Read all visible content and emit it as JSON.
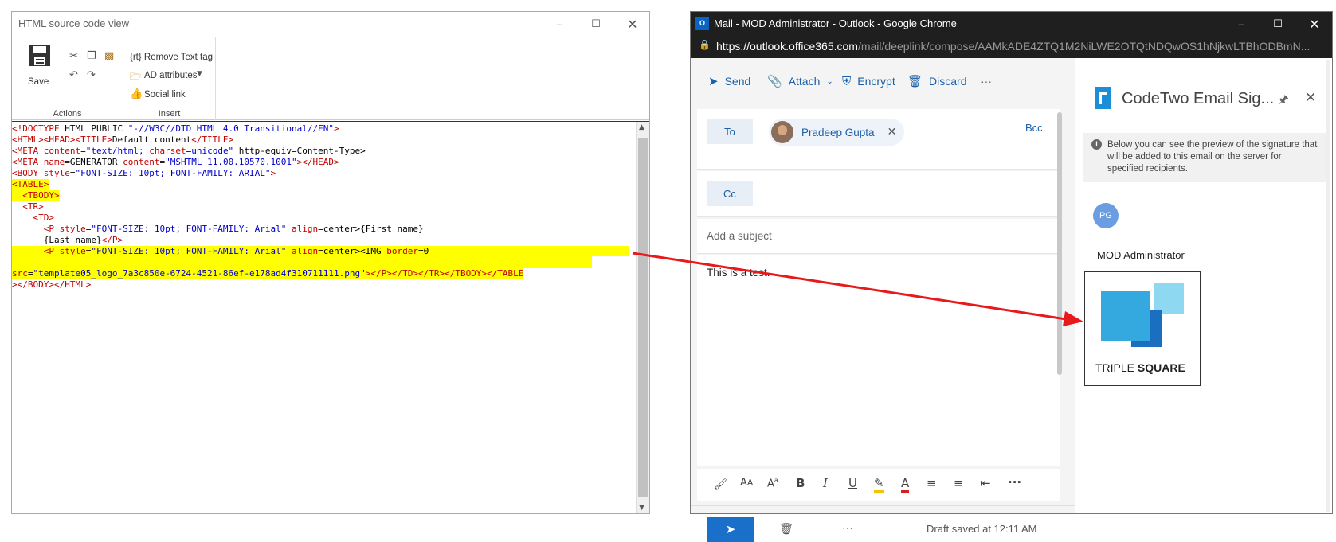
{
  "left_window": {
    "title": "HTML source code view",
    "ribbon": {
      "save_label": "Save",
      "actions_label": "Actions",
      "insert_label": "Insert",
      "remove_text_tag": "{rt} Remove Text tag",
      "ad_attributes": "AD attributes",
      "social_link": "Social link"
    },
    "code_lines": [
      [
        {
          "t": "<!DOCTYPE ",
          "c": "r"
        },
        {
          "t": "HTML PUBLIC ",
          "c": "k"
        },
        {
          "t": "\"-//W3C//DTD HTML 4.0 Transitional//EN\"",
          "c": "b"
        },
        {
          "t": ">",
          "c": "r"
        }
      ],
      [
        {
          "t": "<HTML><HEAD><TITLE>",
          "c": "r"
        },
        {
          "t": "Default content",
          "c": "k"
        },
        {
          "t": "</TITLE>",
          "c": "r"
        }
      ],
      [
        {
          "t": "<META ",
          "c": "r"
        },
        {
          "t": "content",
          "c": "r"
        },
        {
          "t": "=",
          "c": "k"
        },
        {
          "t": "\"text/html; ",
          "c": "b"
        },
        {
          "t": "charset",
          "c": "r"
        },
        {
          "t": "=",
          "c": "k"
        },
        {
          "t": "unicode\"",
          "c": "b"
        },
        {
          "t": " http-equiv=Content-Type>",
          "c": "k"
        }
      ],
      [
        {
          "t": "<META ",
          "c": "r"
        },
        {
          "t": "name",
          "c": "r"
        },
        {
          "t": "=GENERATOR ",
          "c": "k"
        },
        {
          "t": "content",
          "c": "r"
        },
        {
          "t": "=",
          "c": "k"
        },
        {
          "t": "\"MSHTML 11.00.10570.1001\"",
          "c": "b"
        },
        {
          "t": "></HEAD>",
          "c": "r"
        }
      ],
      [
        {
          "t": "<BODY ",
          "c": "r"
        },
        {
          "t": "style",
          "c": "r"
        },
        {
          "t": "=",
          "c": "k"
        },
        {
          "t": "\"FONT-SIZE: 10pt; FONT-FAMILY: ARIAL\"",
          "c": "b"
        },
        {
          "t": ">",
          "c": "r"
        }
      ],
      [
        {
          "t": "<TABLE>",
          "c": "r",
          "hl": true
        }
      ],
      [
        {
          "t": "  <TBODY>",
          "c": "r",
          "hl": true
        }
      ],
      [
        {
          "t": "  <TR>",
          "c": "r"
        }
      ],
      [
        {
          "t": "    <TD>",
          "c": "r"
        }
      ],
      [
        {
          "t": "      <P ",
          "c": "r"
        },
        {
          "t": "style",
          "c": "r"
        },
        {
          "t": "=",
          "c": "k"
        },
        {
          "t": "\"FONT-SIZE: 10pt; FONT-FAMILY: Arial\"",
          "c": "b"
        },
        {
          "t": " ",
          "c": "k"
        },
        {
          "t": "align",
          "c": "r"
        },
        {
          "t": "=center>{First name}",
          "c": "k"
        }
      ],
      [
        {
          "t": "      {Last name}",
          "c": "k"
        },
        {
          "t": "</P>",
          "c": "r"
        }
      ],
      [
        {
          "t": "      <P ",
          "c": "r",
          "hl": true
        },
        {
          "t": "style",
          "c": "r",
          "hl": true
        },
        {
          "t": "=",
          "c": "k",
          "hl": true
        },
        {
          "t": "\"FONT-SIZE: 10pt; FONT-FAMILY: Arial\"",
          "c": "b",
          "hl": true
        },
        {
          "t": " ",
          "c": "k",
          "hl": true
        },
        {
          "t": "align",
          "c": "r",
          "hl": true
        },
        {
          "t": "=center><IMG ",
          "c": "k",
          "hl": true
        },
        {
          "t": "border",
          "c": "r",
          "hl": true
        },
        {
          "t": "=0                                      ",
          "c": "k",
          "hl": true
        }
      ],
      [
        {
          "t": "                                                                                                              ",
          "c": "k",
          "hl": true
        }
      ],
      [
        {
          "t": "src",
          "c": "r",
          "hl": true
        },
        {
          "t": "=",
          "c": "k",
          "hl": true
        },
        {
          "t": "\"template05_logo_7a3c850e-6724-4521-86ef-e178ad4f310711111.png\"",
          "c": "b",
          "hl": true
        },
        {
          "t": "></P></TD></TR></TBODY></TABLE",
          "c": "r",
          "hl": true
        }
      ],
      [
        {
          "t": "></BODY></HTML>",
          "c": "r"
        }
      ]
    ]
  },
  "right_window": {
    "title": "Mail - MOD Administrator - Outlook - Google Chrome",
    "url_host": "https://outlook.office365.com",
    "url_path": "/mail/deeplink/compose/AAMkADE4ZTQ1M2NiLWE2OTQtNDQwOS1hNjkwLTBhODBmN...",
    "toolbar": {
      "send": "Send",
      "attach": "Attach",
      "encrypt": "Encrypt",
      "discard": "Discard",
      "more": "···"
    },
    "to_label": "To",
    "recipient": "Pradeep Gupta",
    "bcc_label": "Bcc",
    "cc_label": "Cc",
    "subject_placeholder": "Add a subject",
    "body_text": "This is a test.",
    "draft_status": "Draft saved at 12:11 AM",
    "more_dots": "···",
    "format_more": "···",
    "side_panel": {
      "title": "CodeTwo Email Sig...",
      "info_text": "Below you can see the preview of the signature that will be added to this email on the server for specified recipients.",
      "avatar_initials": "PG",
      "sender_name": "MOD Administrator",
      "logo_text_light": "TRIPLE ",
      "logo_text_bold": "SQUARE"
    },
    "icons": [
      "outlook-logo-icon",
      "lock-icon",
      "send-icon",
      "paperclip-icon",
      "shield-icon",
      "trash-icon",
      "codetwo-logo-icon",
      "pin-icon",
      "close-icon",
      "info-icon"
    ]
  },
  "colors": {
    "highlight": "#ffff00",
    "tag_red": "#c00000",
    "value_blue": "#0000cc",
    "outlook_blue": "#1a5fa8",
    "send_button": "#1a6fc9",
    "arrow": "#e8191b"
  }
}
